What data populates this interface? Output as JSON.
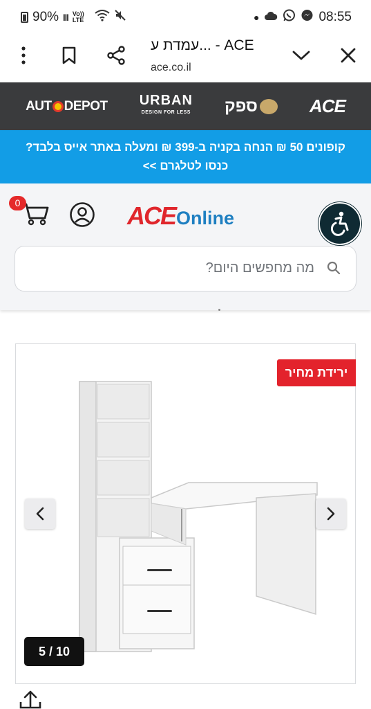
{
  "status_bar": {
    "battery": "90%",
    "signal": "lll",
    "network": "Vo)) LTE",
    "wifi_label": "6",
    "time": "08:55",
    "icons": [
      "battery-icon",
      "signal-icon",
      "wifi-icon",
      "mute-icon",
      "dot-icon",
      "cloud-icon",
      "whatsapp-icon",
      "messenger-icon"
    ]
  },
  "browser": {
    "title": "עמדת ע... - ACE",
    "url": "ace.co.il",
    "icons": [
      "more-icon",
      "bookmark-icon",
      "share-icon",
      "chevron-down-icon",
      "close-icon"
    ]
  },
  "brands": {
    "auto_a": "AUT",
    "auto_b": "DEPOT",
    "urban": "URBAN",
    "urban_tag": "DESIGN FOR LESS",
    "sapak": "ספק",
    "ace": "ACE"
  },
  "promo": {
    "line1": "קופונים 50 ₪ הנחה בקניה ב-399 ₪ ומעלה באתר אייס בלבד?",
    "line2": "כנסו לטלגרם >>"
  },
  "header": {
    "cart_count": "0",
    "logo_ace": "ACE",
    "logo_online": "Online",
    "search_placeholder": "מה מחפשים היום?",
    "colors": {
      "logo_red": "#e0262c",
      "logo_blue": "#1e7fc1",
      "badge_red": "#e52a2a"
    }
  },
  "product": {
    "badge": "ירידת מחיר",
    "counter": "5 / 10",
    "colors": {
      "badge_bg": "#e3232c",
      "promo_bg": "#129de6"
    }
  }
}
